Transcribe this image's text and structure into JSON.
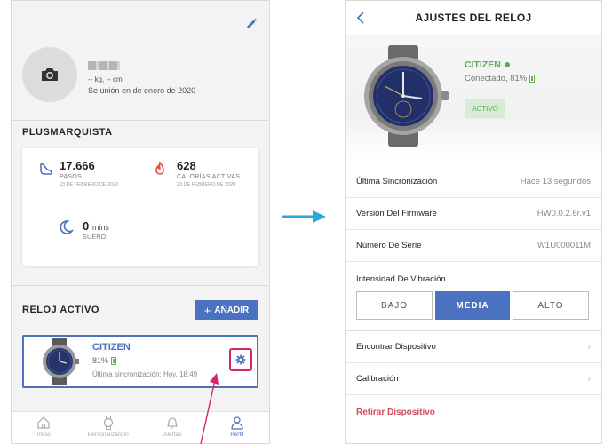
{
  "colors": {
    "accent_blue": "#4a72c0",
    "highlight_pink": "#d6246e",
    "connected_green": "#5aa85a",
    "danger_red": "#d0505a"
  },
  "profile": {
    "edit_icon": "pencil-icon",
    "avatar_icon": "camera-icon",
    "stats": "-- kg, -- cm",
    "joined": "Se unión en de enero de 2020"
  },
  "records": {
    "title": "PLUSMARQUISTA",
    "steps": {
      "value": "17.666",
      "label": "PASOS",
      "date": "23 DE FEBRERO DE 2020",
      "icon": "shoe-icon"
    },
    "calories": {
      "value": "628",
      "label": "CALORÍAS ACTIVAS",
      "date": "23 DE FEBRERO DE 2020",
      "icon": "flame-icon"
    },
    "sleep": {
      "value": "0",
      "unit": "mins",
      "label": "SUEÑO",
      "icon": "moon-icon"
    }
  },
  "active_watch": {
    "title": "RELOJ  ACTIVO",
    "add_label": "AÑADIR",
    "name": "CITIZEN",
    "battery": "81%",
    "battery_fraction": 0.81,
    "last_sync": "Última sincronización: Hoy, 18:49"
  },
  "tabbar": {
    "tabs": [
      {
        "label": "Inicio",
        "icon": "home-icon"
      },
      {
        "label": "Personalización",
        "icon": "watch-icon"
      },
      {
        "label": "Alertas",
        "icon": "bell-icon"
      },
      {
        "label": "Perfil",
        "icon": "person-icon",
        "active": true
      }
    ]
  },
  "settings": {
    "title": "AJUSTES DEL RELOJ",
    "brand": "CITIZEN",
    "connected": "Conectado, 81%",
    "badge": "ACTIVO",
    "rows": [
      {
        "label": "Última Sincronización",
        "value": "Hace 13 segundos"
      },
      {
        "label": "Versión Del Firmware",
        "value": "HW0.0.2.6r.v1"
      },
      {
        "label": "Número De Serie",
        "value": "W1U000011M"
      }
    ],
    "vibration": {
      "label": "Intensidad De Vibración",
      "options": [
        "BAJO",
        "MEDIA",
        "ALTO"
      ],
      "selected": "MEDIA"
    },
    "find_device": "Encontrar Dispositivo",
    "calibration": "Calibración",
    "remove": "Retirar Dispositivo"
  }
}
